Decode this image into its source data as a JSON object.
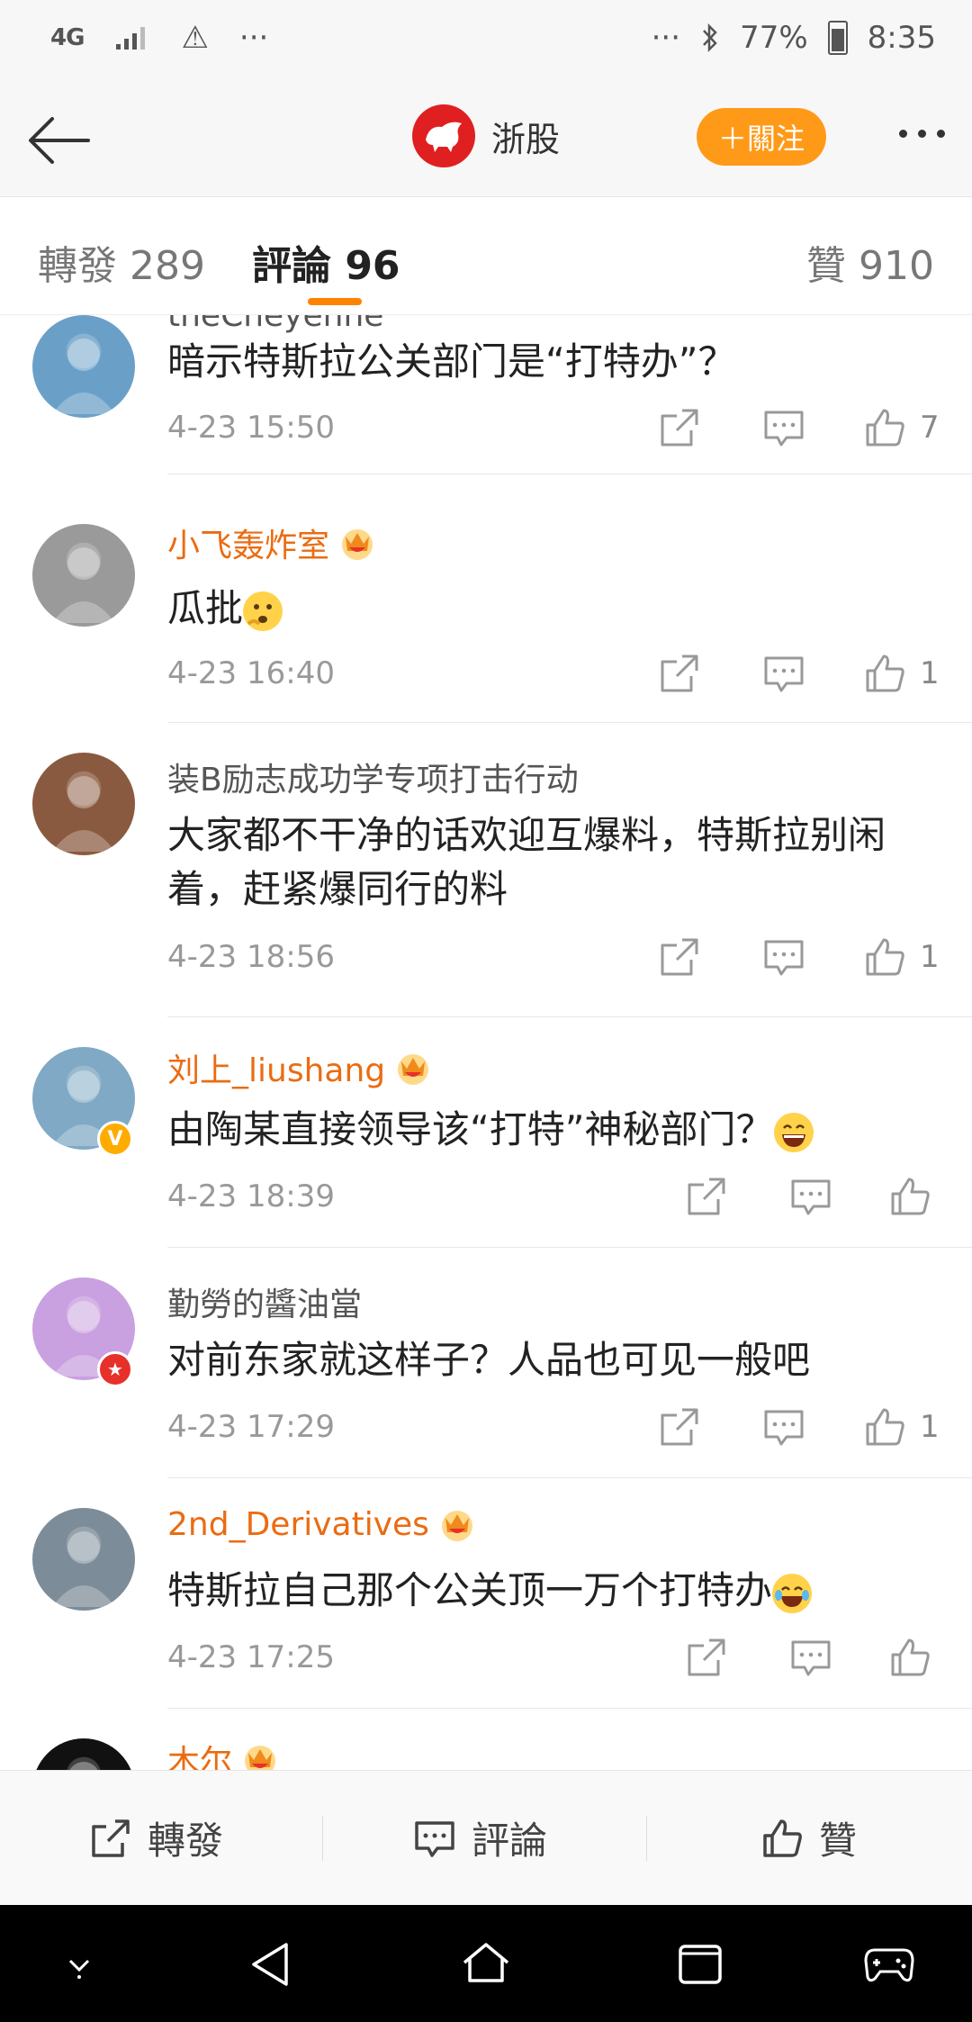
{
  "status_bar": {
    "network": "4G",
    "warning": "⚠",
    "dots_left": "···",
    "dots_right": "···",
    "battery": "77%",
    "time": "8:35"
  },
  "nav": {
    "title": "浙股",
    "follow_label": "＋關注"
  },
  "tabs": {
    "repost": "轉發 289",
    "comment": "評論 96",
    "like": "贊 910"
  },
  "comments": [
    {
      "username": "theCheyenne",
      "vip": false,
      "text": "暗示特斯拉公关部门是“打特办”？",
      "time": "4-23 15:50",
      "likes": "7",
      "avatar_color": "#6aa0c8"
    },
    {
      "username": "小飞轰炸室",
      "vip": true,
      "text": "瓜批",
      "emoji": "thinking",
      "time": "4-23 16:40",
      "likes": "1",
      "avatar_color": "#9a9a9a"
    },
    {
      "username": "装B励志成功学专项打击行动",
      "vip": false,
      "text": "大家都不干净的话欢迎互爆料，特斯拉别闲着，赶紧爆同行的料",
      "time": "4-23 18:56",
      "likes": "1",
      "avatar_color": "#8a5a40"
    },
    {
      "username": "刘上_liushang",
      "vip": true,
      "text": "由陶某直接领导该“打特”神秘部门？",
      "emoji": "laugh",
      "time": "4-23 18:39",
      "likes": "",
      "avatar_color": "#7fa9c4",
      "badge": "V"
    },
    {
      "username": "勤勞的醬油當",
      "vip": false,
      "text": "对前东家就这样子？人品也可见一般吧",
      "time": "4-23 17:29",
      "likes": "1",
      "avatar_color": "#c9a0e0",
      "badge": "★"
    },
    {
      "username": "2nd_Derivatives",
      "vip": true,
      "text": "特斯拉自己那个公关顶一万个打特办",
      "emoji": "cry-laugh",
      "time": "4-23 17:25",
      "likes": "",
      "avatar_color": "#7c8c98"
    },
    {
      "username": "木尔",
      "vip": true,
      "text": "",
      "time": "",
      "likes": "",
      "avatar_color": "#111111"
    }
  ],
  "toolbar": {
    "repost": "轉發",
    "comment": "評論",
    "like": "贊"
  },
  "colors": {
    "accent": "#ff8200",
    "follow": "#ff9a18",
    "vip_name": "#ea6c12"
  }
}
